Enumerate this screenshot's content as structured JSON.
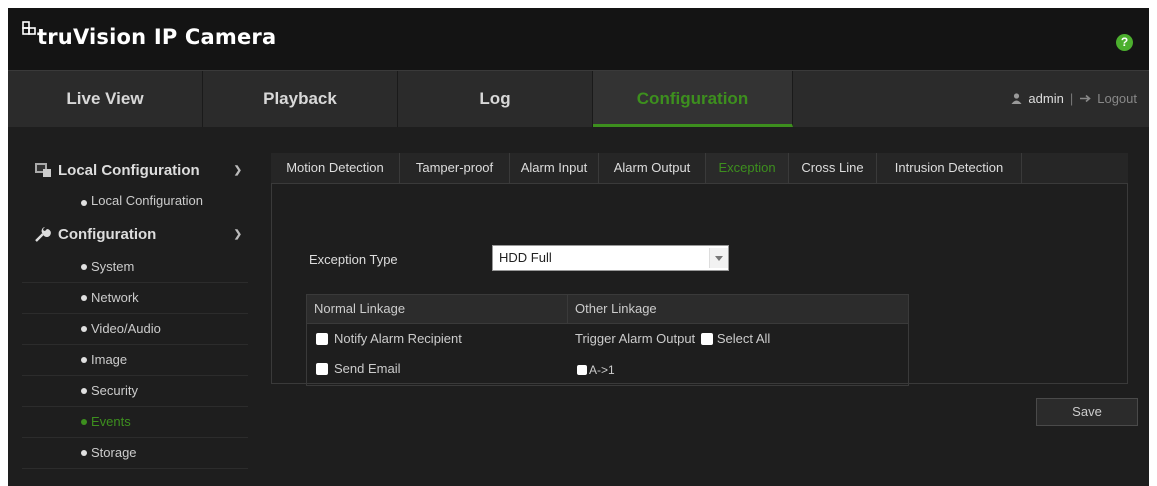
{
  "app": {
    "brand": "truVision IP Camera",
    "help_label": "?"
  },
  "nav": {
    "tabs": [
      {
        "label": "Live View",
        "active": false
      },
      {
        "label": "Playback",
        "active": false
      },
      {
        "label": "Log",
        "active": false
      },
      {
        "label": "Configuration",
        "active": true
      }
    ],
    "user": "admin",
    "separator": "|",
    "logout": "Logout"
  },
  "sidebar": {
    "groups": [
      {
        "title": "Local Configuration",
        "icon": "local-config-icon",
        "items": [
          "Local Configuration"
        ]
      },
      {
        "title": "Configuration",
        "icon": "wrench-icon",
        "items": [
          "System",
          "Network",
          "Video/Audio",
          "Image",
          "Security",
          "Events",
          "Storage"
        ]
      }
    ],
    "active_item": "Events"
  },
  "content": {
    "tabs": [
      "Motion Detection",
      "Tamper-proof",
      "Alarm Input",
      "Alarm Output",
      "Exception",
      "Cross Line",
      "Intrusion Detection"
    ],
    "active_tab": "Exception",
    "exception_type_label": "Exception Type",
    "exception_type_value": "HDD Full",
    "normal_linkage_header": "Normal Linkage",
    "other_linkage_header": "Other Linkage",
    "normal_linkage": [
      "Notify Alarm Recipient",
      "Send Email"
    ],
    "trigger_alarm_output": "Trigger Alarm Output",
    "select_all": "Select All",
    "alarm_output": "A->1",
    "save_label": "Save"
  },
  "colors": {
    "accent": "#3d8f1e",
    "background": "#1e1e1e",
    "header": "#141414"
  }
}
